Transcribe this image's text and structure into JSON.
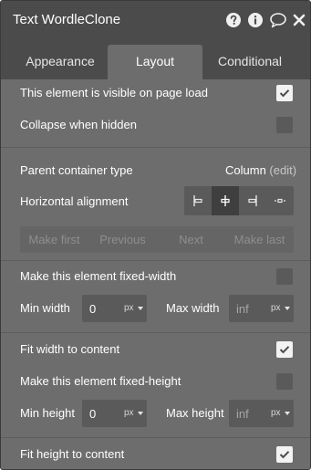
{
  "header": {
    "title": "Text WordleClone"
  },
  "tabs": [
    {
      "label": "Appearance"
    },
    {
      "label": "Layout"
    },
    {
      "label": "Conditional"
    }
  ],
  "layout": {
    "visible_on_load": {
      "label": "This element is visible on page load",
      "checked": true
    },
    "collapse_when_hidden": {
      "label": "Collapse when hidden",
      "checked": false
    },
    "parent_container": {
      "label": "Parent container type",
      "value": "Column",
      "edit": "(edit)"
    },
    "horizontal_alignment": {
      "label": "Horizontal alignment",
      "selected": "center"
    },
    "order_buttons": [
      "Make first",
      "Previous",
      "Next",
      "Make last"
    ],
    "fixed_width": {
      "label": "Make this element fixed-width",
      "checked": false
    },
    "min_width": {
      "label": "Min width",
      "value": "0",
      "unit": "px"
    },
    "max_width": {
      "label": "Max width",
      "placeholder": "inf",
      "unit": "px"
    },
    "fit_width": {
      "label": "Fit width to content",
      "checked": true
    },
    "fixed_height": {
      "label": "Make this element fixed-height",
      "checked": false
    },
    "min_height": {
      "label": "Min height",
      "value": "0",
      "unit": "px"
    },
    "max_height": {
      "label": "Max height",
      "placeholder": "inf",
      "unit": "px"
    },
    "fit_height": {
      "label": "Fit height to content",
      "checked": true
    }
  }
}
